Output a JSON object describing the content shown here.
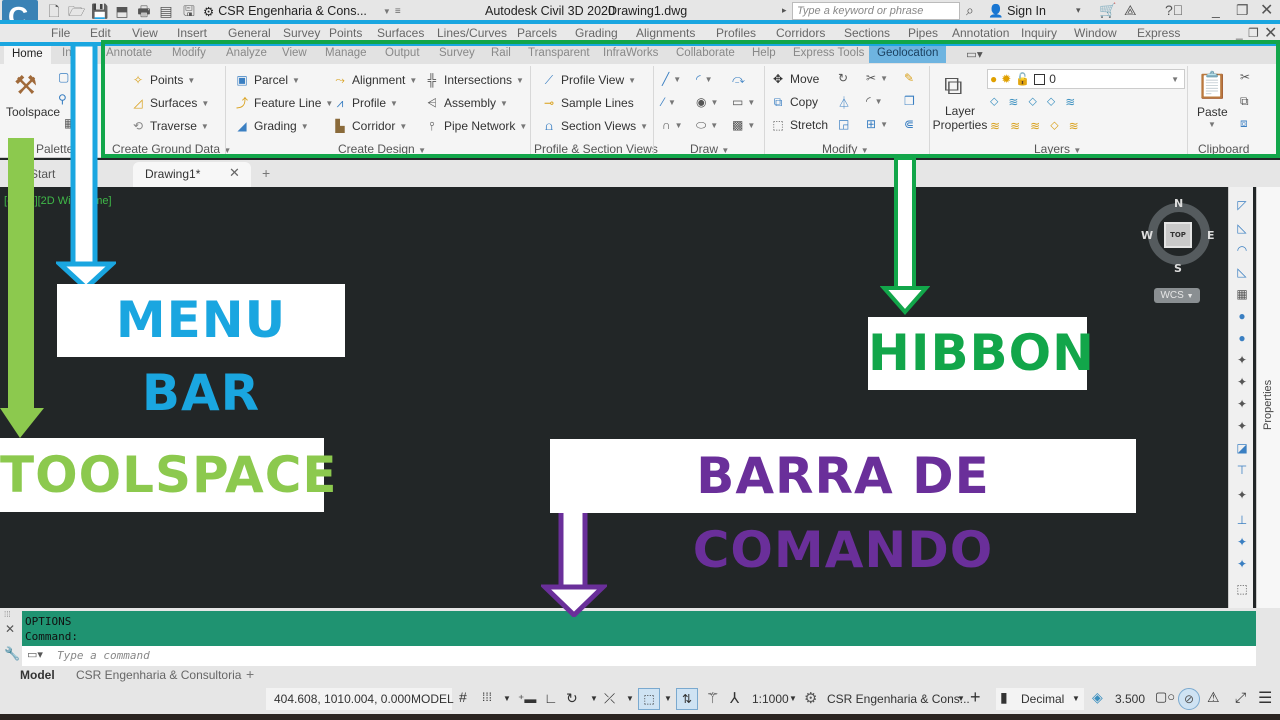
{
  "titlebar": {
    "app_badge": "C3D",
    "workspace": "CSR Engenharia & Cons...",
    "app_title": "Autodesk Civil 3D 2020",
    "document": "Drawing1.dwg",
    "search_placeholder": "Type a keyword or phrase",
    "sign_in": "Sign In"
  },
  "menubar": {
    "items": [
      "File",
      "Edit",
      "View",
      "Insert",
      "General",
      "Survey",
      "Points",
      "Surfaces",
      "Lines/Curves",
      "Parcels",
      "Grading",
      "Alignments",
      "Profiles",
      "Corridors",
      "Sections",
      "Pipes",
      "Annotation",
      "Inquiry",
      "Window",
      "Express"
    ]
  },
  "ribbon_tabs": {
    "items": [
      "Home",
      "In",
      "Annotate",
      "Modify",
      "Analyze",
      "View",
      "Manage",
      "Output",
      "Survey",
      "Rail",
      "Transparent",
      "InfraWorks",
      "Collaborate",
      "Help",
      "Express Tools",
      "Geolocation"
    ],
    "active": "Home"
  },
  "ribbon": {
    "palettes": {
      "toolspace": "Toolspace",
      "title": "Palettes"
    },
    "ground": {
      "items": [
        "Points",
        "Surfaces",
        "Traverse"
      ],
      "title": "Create Ground Data"
    },
    "design": {
      "col1": [
        "Parcel",
        "Feature Line",
        "Grading"
      ],
      "col2": [
        "Alignment",
        "Profile",
        "Corridor"
      ],
      "col3": [
        "Intersections",
        "Assembly",
        "Pipe Network"
      ],
      "title": "Create Design"
    },
    "views": {
      "items": [
        "Profile View",
        "Sample Lines",
        "Section Views"
      ],
      "title": "Profile & Section Views"
    },
    "draw": {
      "title": "Draw"
    },
    "modify": {
      "items": [
        "Move",
        "Copy",
        "Stretch"
      ],
      "title": "Modify"
    },
    "layers": {
      "button": "Layer Properties",
      "current_layer": "0",
      "title": "Layers"
    },
    "clipboard": {
      "paste": "Paste",
      "title": "Clipboard"
    }
  },
  "filetabs": {
    "start": "Start",
    "drawing": "Drawing1*"
  },
  "viewport": {
    "label": "[-][Top][2D Wireframe]",
    "viewcube": {
      "n": "N",
      "s": "S",
      "e": "E",
      "w": "W",
      "face": "TOP",
      "ucs": "WCS"
    }
  },
  "properties_palette": {
    "label": "Properties"
  },
  "command": {
    "history": [
      "OPTIONS",
      "Command:"
    ],
    "placeholder": "Type a command"
  },
  "layout_tabs": {
    "items": [
      "Model",
      "CSR Engenharia & Consultoria"
    ],
    "active": "Model"
  },
  "statusbar": {
    "coords": "404.608, 1010.004, 0.000",
    "space": "MODEL",
    "scale": "1:1000",
    "workspace": "CSR Engenharia & Cons...",
    "units": "Decimal",
    "lineweight": "3.500"
  },
  "annotations": {
    "menu_bar": {
      "label": "MENU BAR",
      "color": "#1aa6e0"
    },
    "ribbon": {
      "label": "HIBBON",
      "color": "#12a64a"
    },
    "toolspace": {
      "label": "TOOLSPACE",
      "color": "#8cc94e"
    },
    "command_bar": {
      "label": "BARRA DE COMANDO",
      "color": "#6a2f9a"
    }
  }
}
